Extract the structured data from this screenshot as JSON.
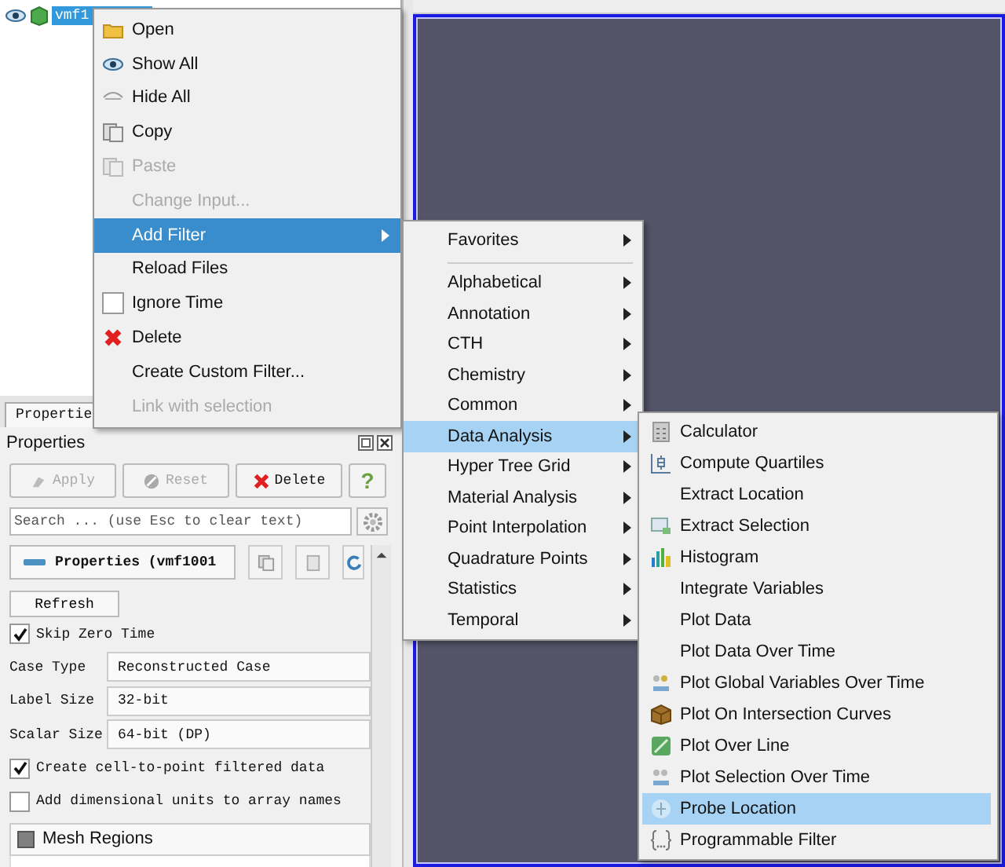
{
  "pipeline": {
    "items": [
      {
        "label": "vmf1",
        "selected": true,
        "visible": true
      }
    ]
  },
  "context_menu": {
    "items": [
      {
        "kind": "item",
        "label": "Open",
        "disabled": false,
        "selected": false
      },
      {
        "kind": "item",
        "label": "Show All",
        "disabled": false,
        "selected": false
      },
      {
        "kind": "item",
        "label": "Hide All",
        "disabled": false,
        "selected": false
      },
      {
        "kind": "item",
        "label": "Copy",
        "disabled": false,
        "selected": false
      },
      {
        "kind": "item",
        "label": "Paste",
        "disabled": true,
        "selected": false
      },
      {
        "kind": "item",
        "label": "Change Input...",
        "disabled": true,
        "selected": false
      },
      {
        "kind": "submenu",
        "label": "Add Filter",
        "disabled": false,
        "selected": true
      },
      {
        "kind": "item",
        "label": "Reload Files",
        "disabled": false,
        "selected": false
      },
      {
        "kind": "checkbox",
        "label": "Ignore Time",
        "disabled": false,
        "selected": false,
        "checked": false
      },
      {
        "kind": "item",
        "label": "Delete",
        "disabled": false,
        "selected": false
      },
      {
        "kind": "item",
        "label": "Create Custom Filter...",
        "disabled": false,
        "selected": false
      },
      {
        "kind": "item",
        "label": "Link with selection",
        "disabled": true,
        "selected": false
      }
    ]
  },
  "filter_categories_menu": {
    "items": [
      {
        "kind": "submenu",
        "label": "Favorites",
        "selected": false
      },
      {
        "kind": "separator"
      },
      {
        "kind": "submenu",
        "label": "Alphabetical",
        "selected": false
      },
      {
        "kind": "submenu",
        "label": "Annotation",
        "selected": false
      },
      {
        "kind": "submenu",
        "label": "CTH",
        "selected": false
      },
      {
        "kind": "submenu",
        "label": "Chemistry",
        "selected": false
      },
      {
        "kind": "submenu",
        "label": "Common",
        "selected": false
      },
      {
        "kind": "submenu",
        "label": "Data Analysis",
        "selected": true
      },
      {
        "kind": "submenu",
        "label": "Hyper Tree Grid",
        "selected": false
      },
      {
        "kind": "submenu",
        "label": "Material Analysis",
        "selected": false
      },
      {
        "kind": "submenu",
        "label": "Point Interpolation",
        "selected": false
      },
      {
        "kind": "submenu",
        "label": "Quadrature Points",
        "selected": false
      },
      {
        "kind": "submenu",
        "label": "Statistics",
        "selected": false
      },
      {
        "kind": "submenu",
        "label": "Temporal",
        "selected": false
      }
    ]
  },
  "data_analysis_menu": {
    "items": [
      {
        "label": "Calculator",
        "selected": false
      },
      {
        "label": "Compute Quartiles",
        "selected": false
      },
      {
        "label": "Extract Location",
        "selected": false
      },
      {
        "label": "Extract Selection",
        "selected": false
      },
      {
        "label": "Histogram",
        "selected": false
      },
      {
        "label": "Integrate Variables",
        "selected": false
      },
      {
        "label": "Plot Data",
        "selected": false
      },
      {
        "label": "Plot Data Over Time",
        "selected": false
      },
      {
        "label": "Plot Global Variables Over Time",
        "selected": false
      },
      {
        "label": "Plot On Intersection Curves",
        "selected": false
      },
      {
        "label": "Plot Over Line",
        "selected": false
      },
      {
        "label": "Plot Selection Over Time",
        "selected": false
      },
      {
        "label": "Probe Location",
        "selected": true
      },
      {
        "label": "Programmable Filter",
        "selected": false
      }
    ]
  },
  "properties_panel": {
    "tab": "Propertie",
    "title": "Properties",
    "buttons": [
      {
        "label": "Apply",
        "disabled": true
      },
      {
        "label": "Reset",
        "disabled": true
      },
      {
        "label": "Delete",
        "disabled": false
      },
      {
        "label": "?",
        "disabled": false
      }
    ],
    "search": {
      "placeholder": "Search ... (use Esc to clear text)"
    },
    "section": {
      "title": "Properties (vmf1001"
    },
    "refresh_button": "Refresh",
    "options": [
      {
        "kind": "checkbox",
        "label": "Skip Zero Time",
        "checked": true
      },
      {
        "kind": "select",
        "label": "Case Type",
        "value": "Reconstructed Case"
      },
      {
        "kind": "select",
        "label": "Label Size",
        "value": "32-bit"
      },
      {
        "kind": "select",
        "label": "Scalar Size",
        "value": "64-bit (DP)"
      },
      {
        "kind": "checkbox",
        "label": "Create cell-to-point filtered data",
        "checked": true
      },
      {
        "kind": "checkbox",
        "label": "Add dimensional units to array names",
        "checked": false
      }
    ],
    "mesh_regions": {
      "header": "Mesh Regions",
      "partially_checked": true
    }
  }
}
